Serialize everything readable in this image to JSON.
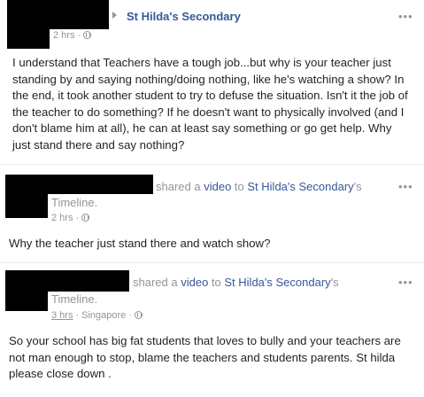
{
  "post1": {
    "group_name": "St Hilda's Secondary",
    "time": "2 hrs",
    "separator": "·",
    "more": "•••",
    "text": "I understand that Teachers have a tough job...but why is your teacher just standing by and saying nothing/doing nothing, like he's watching a show? In the end, it took another student to try to defuse the situation. Isn't it the job of the teacher to do something? If he doesn't want to physically involved (and I don't blame him at all), he can at least say something or go get help. Why just stand there and say nothing?"
  },
  "post2": {
    "shared": "shared a",
    "video": "video",
    "to": "to",
    "target": "St Hilda's Secondary",
    "possessive": "'s",
    "timeline": "Timeline.",
    "time": "2 hrs",
    "separator": "·",
    "more": "•••",
    "text": "Why the teacher just stand there and watch show?"
  },
  "post3": {
    "shared": "shared a",
    "video": "video",
    "to": "to",
    "target": "St Hilda's Secondary",
    "possessive": "'s",
    "timeline": "Timeline.",
    "time": "3 hrs",
    "location": "Singapore",
    "separator": "·",
    "more": "•••",
    "text": "So your school has big fat students that loves to bully and your teachers are not man enough to stop, blame the teachers and students parents. St hilda please close down ."
  },
  "icons": {
    "arrow": "right-triangle-icon",
    "privacy": "globe-icon",
    "more": "more-options-icon"
  },
  "colors": {
    "link": "#365899",
    "meta": "#90949c",
    "text": "#1d2129",
    "redaction": "#000000"
  }
}
